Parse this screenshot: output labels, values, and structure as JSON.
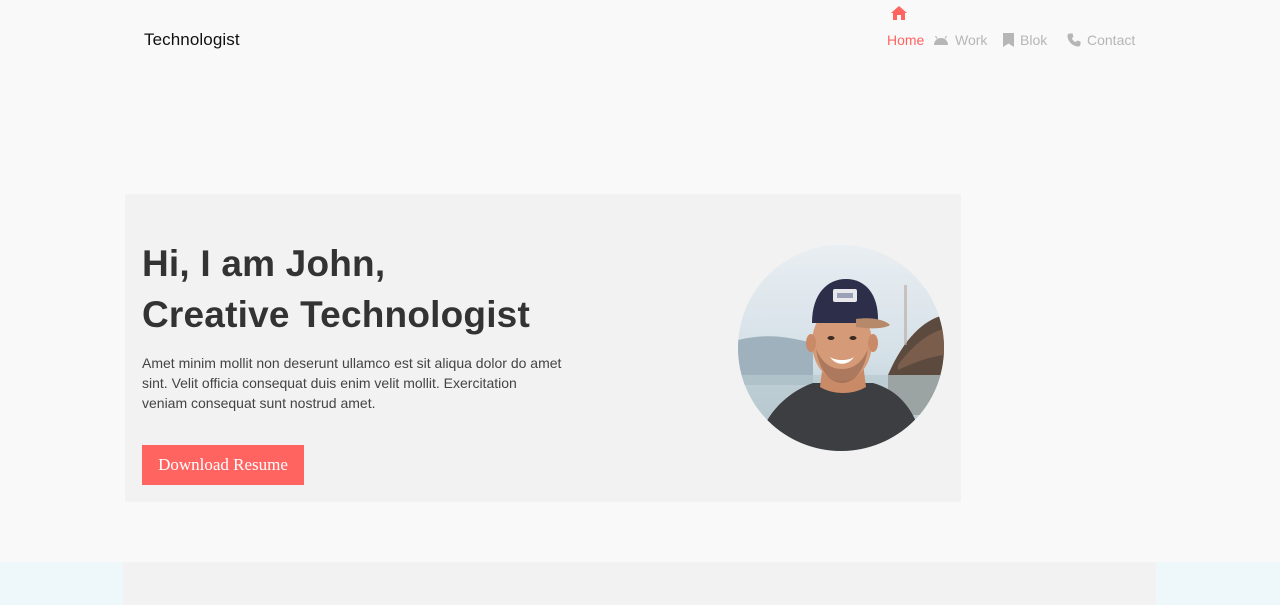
{
  "header": {
    "brand": "Technologist",
    "nav": [
      {
        "label": "Home",
        "icon": "home-icon",
        "active": true
      },
      {
        "label": "Work",
        "icon": "android-icon",
        "active": false
      },
      {
        "label": "Blok",
        "icon": "bookmark-icon",
        "active": false
      },
      {
        "label": "Contact",
        "icon": "phone-icon",
        "active": false
      }
    ]
  },
  "hero": {
    "title_line1": "Hi, I am John,",
    "title_line2": "Creative Technologist",
    "description": "Amet minim mollit non deserunt ullamco est sit aliqua dolor do amet sint. Velit officia consequat duis enim velit mollit. Exercitation veniam consequat sunt nostrud amet.",
    "button_label": "Download Resume"
  },
  "colors": {
    "accent": "#ff6461",
    "nav_inactive": "#b6b6b6",
    "page_background": "#f9f9f9",
    "card_background": "#f2f2f2",
    "lower_band": "#eef7f9"
  }
}
